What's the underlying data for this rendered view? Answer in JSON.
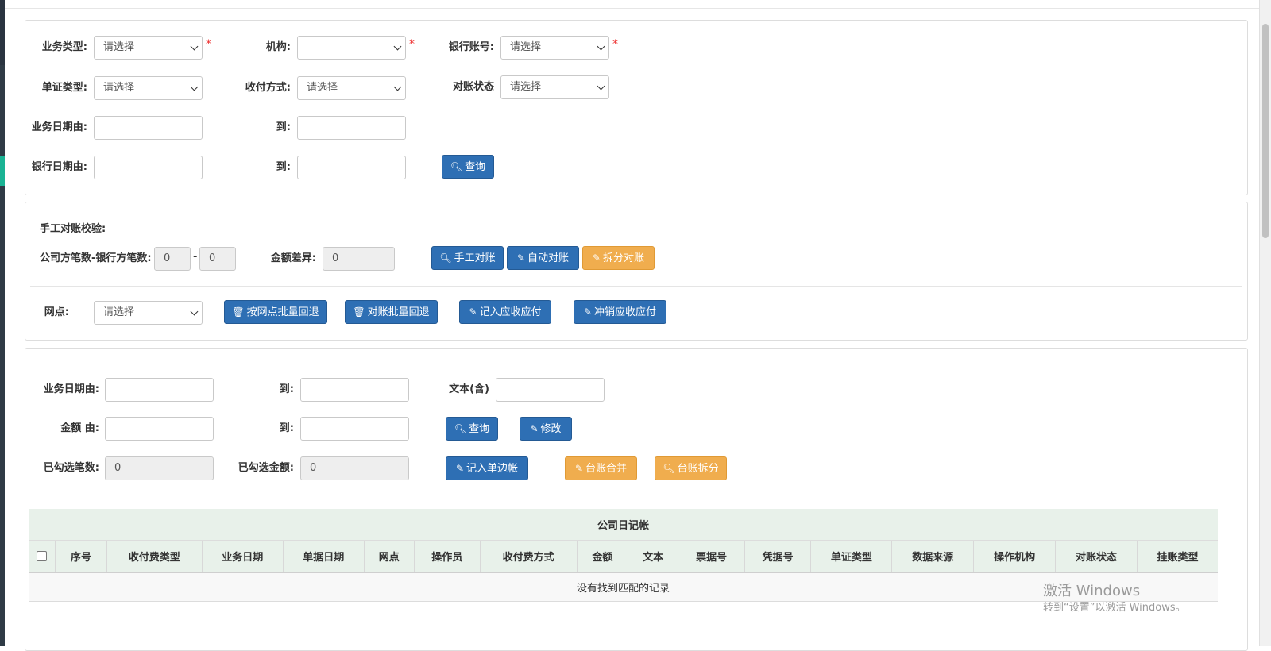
{
  "filters": {
    "biz_type_label": "业务类型:",
    "biz_type_value": "请选择",
    "org_label": "机构:",
    "org_value": "",
    "bank_account_label": "银行账号:",
    "bank_account_value": "请选择",
    "doc_type_label": "单证类型:",
    "doc_type_value": "请选择",
    "pay_method_label": "收付方式:",
    "pay_method_value": "请选择",
    "recon_status_label": "对账状态",
    "recon_status_value": "请选择",
    "biz_date_from_label": "业务日期由:",
    "biz_date_to_label": "到:",
    "bank_date_from_label": "银行日期由:",
    "bank_date_to_label": "到:",
    "required_mark": "*",
    "query_button": "查询"
  },
  "manual": {
    "title": "手工对账校验:",
    "count_label": "公司方笔数-银行方笔数:",
    "company_count": "0",
    "dash": "-",
    "bank_count": "0",
    "diff_label": "金额差异:",
    "diff_value": "0",
    "manual_btn": "手工对账",
    "auto_btn": "自动对账",
    "split_btn": "拆分对账",
    "branch_label": "网点:",
    "branch_value": "请选择",
    "branch_batch_btn": "按网点批量回退",
    "recon_batch_btn": "对账批量回退",
    "record_btn": "记入应收应付",
    "writeoff_btn": "冲销应收应付"
  },
  "ledger_filters": {
    "biz_date_from_label": "业务日期由:",
    "to_label": "到:",
    "text_label": "文本(含)",
    "amount_from_label": "金额 由:",
    "amount_to_label": "到:",
    "query_btn": "查询",
    "edit_btn": "修改",
    "selected_count_label": "已勾选笔数:",
    "selected_count": "0",
    "selected_amount_label": "已勾选金额:",
    "selected_amount": "0",
    "single_side_btn": "记入单边帐",
    "merge_btn": "台账合并",
    "split_btn": "台账拆分"
  },
  "table": {
    "caption": "公司日记帐",
    "columns": [
      "序号",
      "收付费类型",
      "业务日期",
      "单据日期",
      "网点",
      "操作员",
      "收付费方式",
      "金额",
      "文本",
      "票据号",
      "凭据号",
      "单证类型",
      "数据来源",
      "操作机构",
      "对账状态",
      "挂账类型"
    ],
    "empty_text": "没有找到匹配的记录"
  },
  "watermark": {
    "line1": "激活 Windows",
    "line2": "转到“设置”以激活 Windows。"
  },
  "colors": {
    "primary": "#2e6fb4",
    "warning": "#f0ad4e",
    "table_header": "#e8f1ea",
    "required": "#e33333"
  },
  "icons": {
    "search": "search-icon",
    "pencil": "pencil-icon",
    "trash": "trash-icon"
  }
}
